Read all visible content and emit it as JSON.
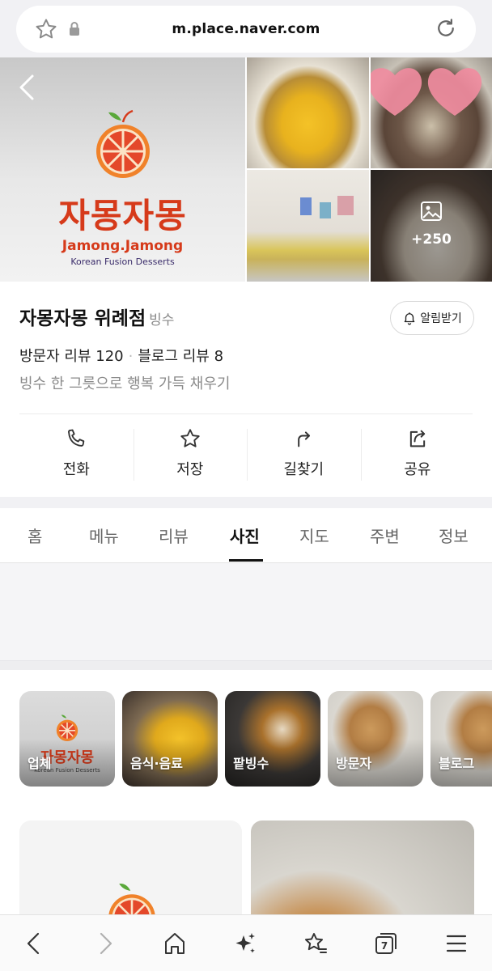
{
  "url_bar": {
    "url": "m.place.naver.com"
  },
  "hero": {
    "photo_count": "+250",
    "logo": {
      "korean": "자몽자몽",
      "english": "Jamong.Jamong",
      "tagline": "Korean Fusion Desserts"
    }
  },
  "place": {
    "name": "자몽자몽 위례점",
    "category": "빙수",
    "alarm_label": "알림받기",
    "visitor_reviews": "방문자 리뷰 120",
    "blog_reviews": "블로그 리뷰 8",
    "separator": "·",
    "slogan": "빙수 한 그릇으로 행복 가득 채우기"
  },
  "actions": [
    {
      "label": "전화",
      "icon": "phone-icon"
    },
    {
      "label": "저장",
      "icon": "star-icon"
    },
    {
      "label": "길찾기",
      "icon": "directions-icon"
    },
    {
      "label": "공유",
      "icon": "share-icon"
    }
  ],
  "tabs": [
    "홈",
    "메뉴",
    "리뷰",
    "사진",
    "지도",
    "주변",
    "정보"
  ],
  "active_tab": "사진",
  "photo_categories": [
    "업체",
    "음식·음료",
    "팥빙수",
    "방문자",
    "블로그"
  ],
  "bottom_nav": [
    "back-icon",
    "forward-icon",
    "home-icon",
    "sparkle-icon",
    "bookmarks-icon",
    "tabs-icon",
    "menu-icon"
  ],
  "tabs_count": "7",
  "colors": {
    "brand": "#d63a1a",
    "accent_orange": "#f0822a",
    "active_tab": "#111111"
  }
}
